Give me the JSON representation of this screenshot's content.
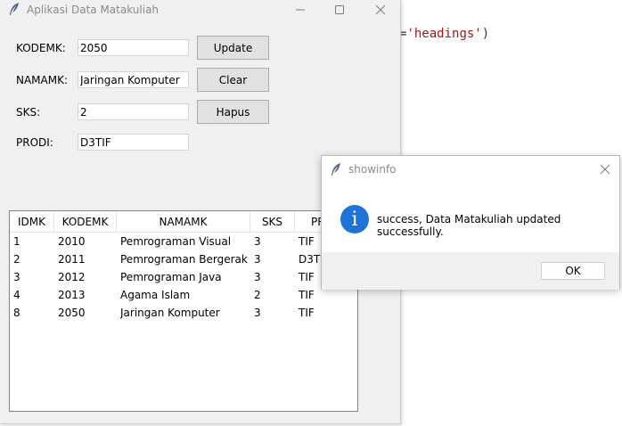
{
  "background": {
    "code_prefix": "=",
    "code_string": "'headings'",
    "code_suffix": ")"
  },
  "main_window": {
    "title": "Aplikasi Data Matakuliah",
    "form": {
      "kodemk_label": "KODEMK:",
      "kodemk_value": "2050",
      "namamk_label": "NAMAMK:",
      "namamk_value": "Jaringan Komputer",
      "sks_label": "SKS:",
      "sks_value": "2",
      "prodi_label": "PRODI:",
      "prodi_value": "D3TIF"
    },
    "buttons": {
      "update": "Update",
      "clear": "Clear",
      "hapus": "Hapus"
    },
    "table": {
      "columns": [
        "IDMK",
        "KODEMK",
        "NAMAMK",
        "SKS",
        "PRODI"
      ],
      "visible_header_prodi": "PR",
      "rows": [
        {
          "idmk": "1",
          "kodemk": "2010",
          "namamk": "Pemrograman Visual",
          "sks": "3",
          "prodi": "TIF"
        },
        {
          "idmk": "2",
          "kodemk": "2011",
          "namamk": "Pemrograman Bergerak",
          "sks": "3",
          "prodi": "D3TIF"
        },
        {
          "idmk": "3",
          "kodemk": "2012",
          "namamk": "Pemrograman Java",
          "sks": "3",
          "prodi": "TIF"
        },
        {
          "idmk": "4",
          "kodemk": "2013",
          "namamk": "Agama Islam",
          "sks": "2",
          "prodi": "TIF"
        },
        {
          "idmk": "8",
          "kodemk": "2050",
          "namamk": "Jaringan Komputer",
          "sks": "3",
          "prodi": "TIF"
        }
      ]
    }
  },
  "dialog": {
    "title": "showinfo",
    "message": "success, Data Matakuliah updated successfully.",
    "icon": "info-icon",
    "ok_label": "OK",
    "accent": "#1f72d6"
  },
  "icons": {
    "app": "feather-icon",
    "minimize": "minimize-icon",
    "maximize": "maximize-icon",
    "close": "close-icon"
  }
}
